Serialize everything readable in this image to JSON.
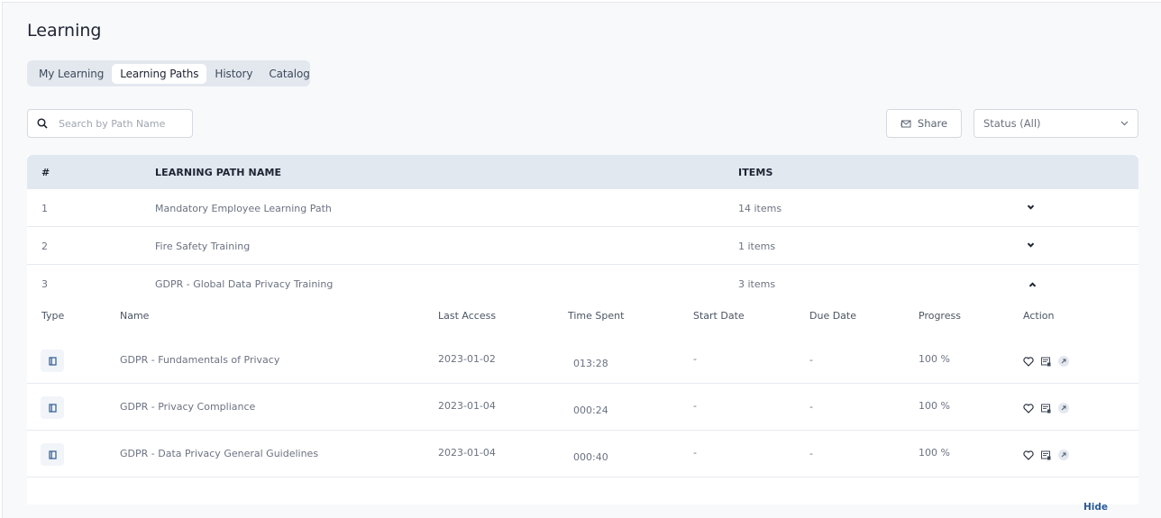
{
  "page": {
    "title": "Learning"
  },
  "tabs": [
    {
      "label": "My Learning",
      "active": false
    },
    {
      "label": "Learning Paths",
      "active": true
    },
    {
      "label": "History",
      "active": false
    },
    {
      "label": "Catalog",
      "active": false
    }
  ],
  "toolbar": {
    "search_placeholder": "Search by Path Name",
    "search_value": "",
    "share_label": "Share",
    "status_selected": "Status (All)"
  },
  "table": {
    "columns": {
      "num": "#",
      "name": "LEARNING PATH NAME",
      "items": "ITEMS"
    },
    "rows": [
      {
        "num": "1",
        "name": "Mandatory Employee Learning Path",
        "items": "14 items",
        "expanded": false
      },
      {
        "num": "2",
        "name": "Fire Safety Training",
        "items": "1 items",
        "expanded": false
      },
      {
        "num": "3",
        "name": "GDPR - Global Data Privacy Training",
        "items": "3 items",
        "expanded": true
      }
    ]
  },
  "detail": {
    "columns": {
      "type": "Type",
      "name": "Name",
      "last_access": "Last Access",
      "time_spent": "Time Spent",
      "start_date": "Start Date",
      "due_date": "Due Date",
      "progress": "Progress",
      "action": "Action"
    },
    "rows": [
      {
        "type_icon": "book-icon",
        "name": "GDPR - Fundamentals of Privacy",
        "last_access": "2023-01-02",
        "time_spent": "013:28",
        "start_date": "-",
        "due_date": "-",
        "progress": "100 %"
      },
      {
        "type_icon": "book-icon",
        "name": "GDPR - Privacy Compliance",
        "last_access": "2023-01-04",
        "time_spent": "000:24",
        "start_date": "-",
        "due_date": "-",
        "progress": "100 %"
      },
      {
        "type_icon": "book-icon",
        "name": "GDPR - Data Privacy General Guidelines",
        "last_access": "2023-01-04",
        "time_spent": "000:40",
        "start_date": "-",
        "due_date": "-",
        "progress": "100 %"
      }
    ],
    "hide_label": "Hide"
  },
  "colors": {
    "accent": "#2a5a9a",
    "header_bg": "#e2e8f0",
    "tabs_bg": "#e3e8ef",
    "page_bg": "#f8f9fb"
  }
}
